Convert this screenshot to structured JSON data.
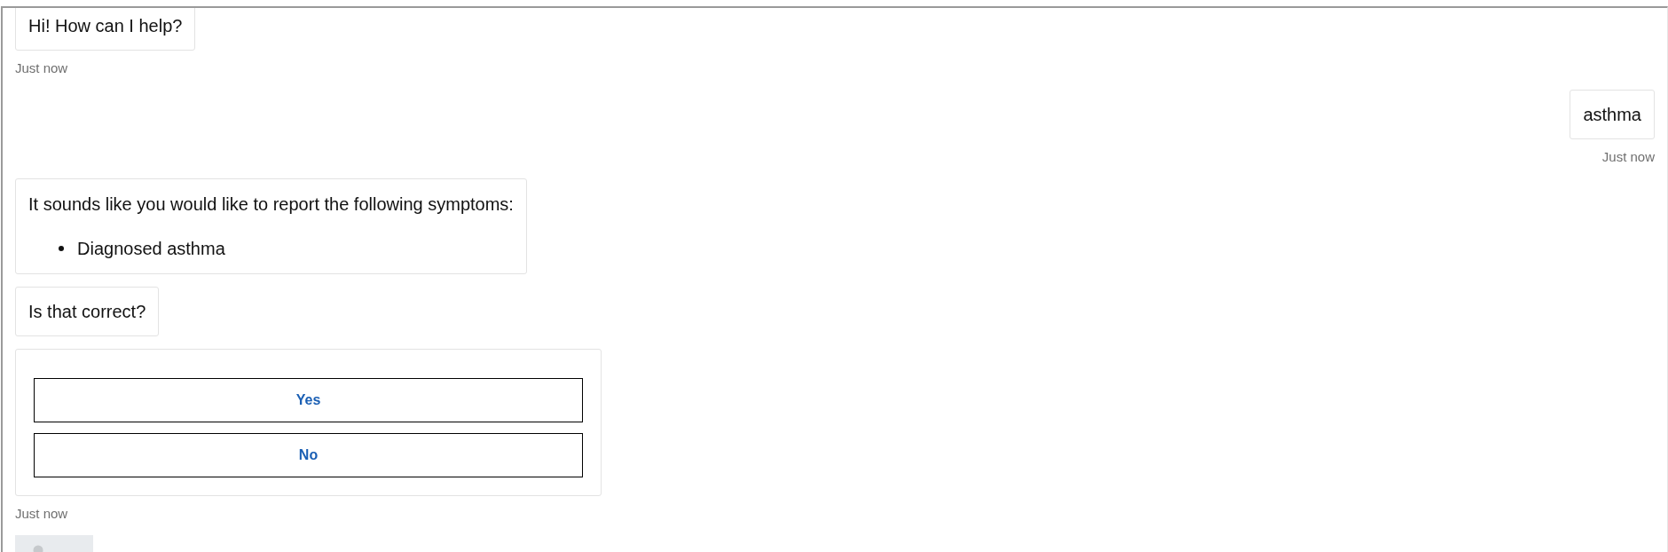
{
  "conversation": {
    "messages": [
      {
        "kind": "text",
        "from_user": false,
        "text": "Hi! How can I help?",
        "timestamp": "Just now"
      },
      {
        "kind": "text",
        "from_user": true,
        "text": "asthma",
        "timestamp": "Just now"
      },
      {
        "kind": "list",
        "from_user": false,
        "text": "It sounds like you would like to report the following symptoms:",
        "items": [
          "Diagnosed asthma"
        ]
      },
      {
        "kind": "text",
        "from_user": false,
        "text": "Is that correct?"
      },
      {
        "kind": "choices",
        "options": [
          "Yes",
          "No"
        ],
        "timestamp": "Just now"
      },
      {
        "kind": "avatar"
      }
    ]
  }
}
